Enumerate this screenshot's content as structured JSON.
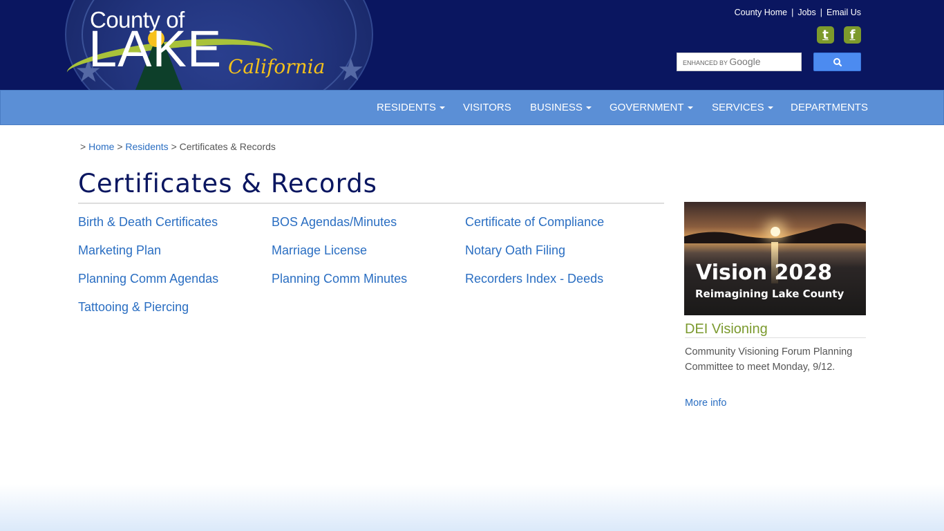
{
  "header": {
    "logo": {
      "county_of": "County of",
      "lake": "LAKE",
      "california": "California"
    },
    "top_links": [
      "County Home",
      "Jobs",
      "Email Us"
    ],
    "social": [
      {
        "name": "twitter",
        "glyph": "t"
      },
      {
        "name": "facebook",
        "glyph": "f"
      }
    ],
    "search": {
      "placeholder_prefix": "ENHANCED BY",
      "placeholder_brand": "Google"
    }
  },
  "nav": {
    "items": [
      {
        "label": "RESIDENTS",
        "has_dropdown": true
      },
      {
        "label": "VISITORS",
        "has_dropdown": false
      },
      {
        "label": "BUSINESS",
        "has_dropdown": true
      },
      {
        "label": "GOVERNMENT",
        "has_dropdown": true
      },
      {
        "label": "SERVICES",
        "has_dropdown": true
      },
      {
        "label": "DEPARTMENTS",
        "has_dropdown": false
      }
    ]
  },
  "breadcrumb": {
    "prefix": ">",
    "items": [
      "Home",
      "Residents",
      "Certificates & Records"
    ],
    "sep": ">"
  },
  "page": {
    "title": "Certificates & Records",
    "links": [
      "Birth & Death Certificates",
      "BOS Agendas/Minutes",
      "Certificate of Compliance",
      "Marketing Plan",
      "Marriage License",
      "Notary Oath Filing",
      "Planning Comm Agendas",
      "Planning Comm Minutes",
      "Recorders Index - Deeds",
      "Tattooing & Piercing"
    ]
  },
  "sidebar": {
    "promo": {
      "title": "Vision 2028",
      "subtitle": "Reimagining Lake  County"
    },
    "heading": "DEI Visioning",
    "text": "Community Visioning Forum Planning Committee to meet Monday, 9/12.",
    "more": "More info"
  },
  "colors": {
    "header_bg": "#0a1660",
    "nav_bg": "#5b8fd6",
    "link": "#2a6ec2",
    "accent_green": "#7b9a2e",
    "title": "#0a1660"
  }
}
